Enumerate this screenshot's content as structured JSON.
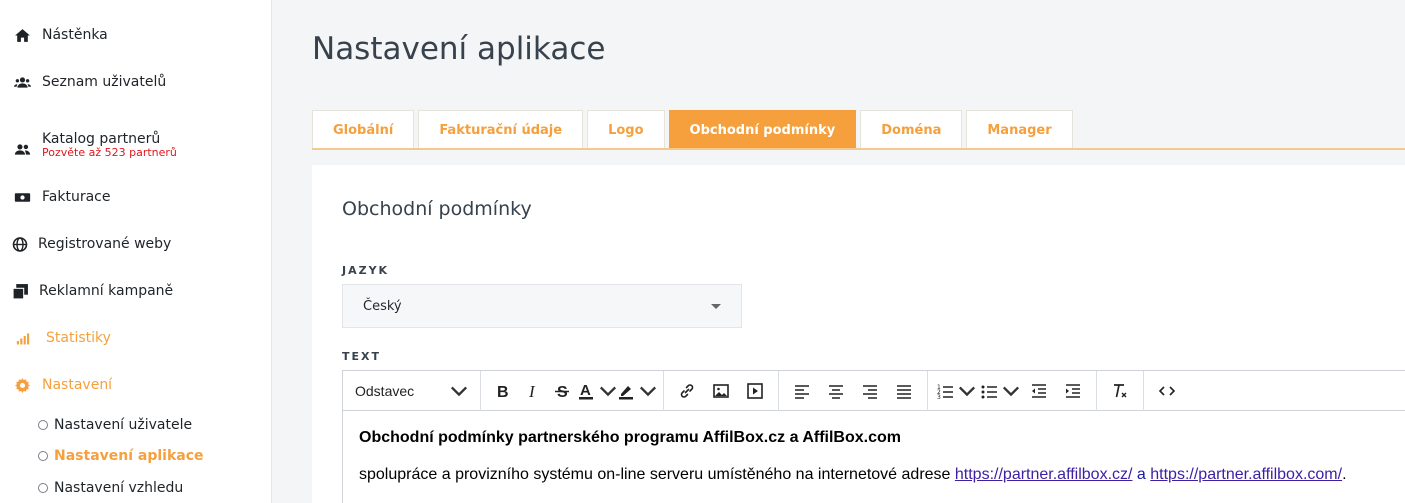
{
  "sidebar": {
    "items": [
      {
        "label": "Nástěnka",
        "icon": "home-icon"
      },
      {
        "label": "Seznam uživatelů",
        "icon": "users-icon"
      },
      {
        "label": "Katalog partnerů",
        "icon": "partners-icon",
        "sub": "Pozvěte až 523 partnerů"
      },
      {
        "label": "Fakturace",
        "icon": "money-icon"
      },
      {
        "label": "Registrované weby",
        "icon": "globe-icon"
      },
      {
        "label": "Reklamní kampaně",
        "icon": "copy-icon"
      },
      {
        "label": "Statistiky",
        "icon": "signal-icon"
      },
      {
        "label": "Nastavení",
        "icon": "gear-icon"
      }
    ],
    "subitems": [
      {
        "label": "Nastavení uživatele"
      },
      {
        "label": "Nastavení aplikace"
      },
      {
        "label": "Nastavení vzhledu"
      }
    ]
  },
  "main": {
    "title": "Nastavení aplikace",
    "tabs": [
      {
        "label": "Globální"
      },
      {
        "label": "Fakturační údaje"
      },
      {
        "label": "Logo"
      },
      {
        "label": "Obchodní podmínky"
      },
      {
        "label": "Doména"
      },
      {
        "label": "Manager"
      }
    ],
    "active_tab": "Obchodní podmínky",
    "card": {
      "title": "Obchodní podmínky",
      "language_label": "JAZYK",
      "language_value": "Český",
      "text_label": "TEXT",
      "editor": {
        "format_value": "Odstavec",
        "heading": "Obchodní podmínky partnerského programu AffilBox.cz a AffilBox.com",
        "para_prefix": "spolupráce a provizního systému on-line serveru umístěného na internetové adrese ",
        "link1": "https://partner.affilbox.cz/",
        "and": " a ",
        "link2": "https://partner.affilbox.com/",
        "para_suffix": "."
      }
    }
  },
  "colors": {
    "accent": "#f5a03c",
    "sub_warning": "#e0161f",
    "title": "#37424d"
  }
}
